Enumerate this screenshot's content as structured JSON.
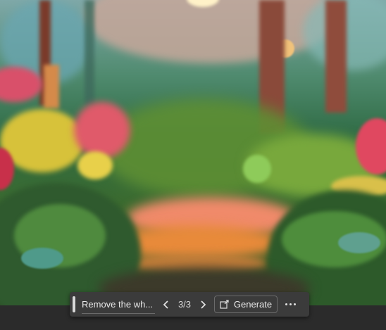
{
  "canvas": {
    "description_icon": "generated-forest-image"
  },
  "toolbar": {
    "prompt_value": "Remove the wh...",
    "counter": "3/3",
    "generate_label": "Generate",
    "prev_icon": "chevron-left-icon",
    "next_icon": "chevron-right-icon",
    "generate_icon": "generate-icon",
    "more_icon": "more-horizontal-icon"
  }
}
